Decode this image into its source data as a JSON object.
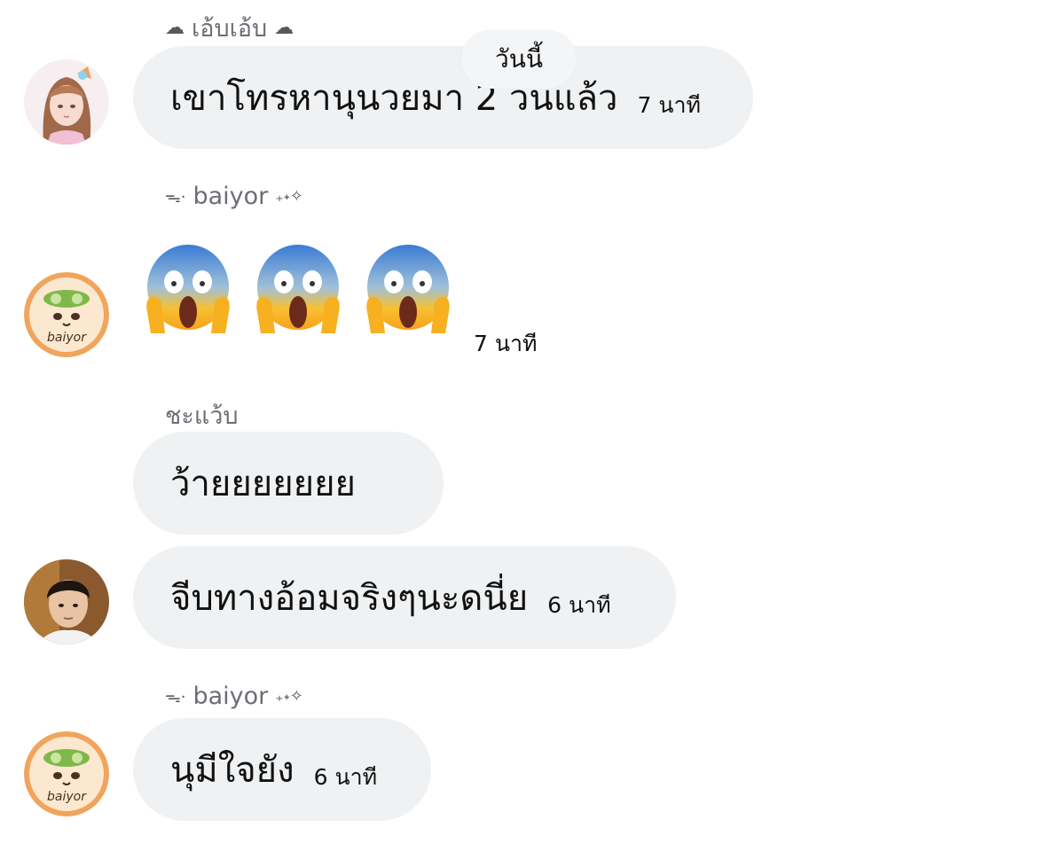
{
  "date_divider": "วันนี้",
  "messages": [
    {
      "sender": "เอ้บเอ้บ",
      "sender_prefix_icon": "cloud-icon",
      "sender_suffix_icon": "cloud-icon",
      "text": "เขาโทรหานุนวยมา 2 วนแล้ว",
      "time": "7 นาที",
      "avatar": "anime-girl-avatar"
    },
    {
      "sender": "baiyor",
      "sender_prefix_icon": "swirl-icon",
      "sender_suffix_icon": "sparkle-icon",
      "emojis": [
        "😱",
        "😱",
        "😱"
      ],
      "time": "7 นาที",
      "avatar": "baiyor-cat-avatar",
      "avatar_text": "baiyor"
    },
    {
      "sender": "ชะแว้บ",
      "text": "ว้ายยยยยยย"
    },
    {
      "text": "จีบทางอ้อมจริงๆนะดนี่ย",
      "time": "6 นาที",
      "avatar": "person-photo-avatar"
    },
    {
      "sender": "baiyor",
      "sender_prefix_icon": "swirl-icon",
      "sender_suffix_icon": "sparkle-icon",
      "text": "นุมีใจยัง",
      "time": "6 นาที",
      "avatar": "baiyor-cat-avatar",
      "avatar_text": "baiyor"
    }
  ],
  "colors": {
    "bubble_bg": "#eff1f3",
    "sender_text": "#6b6f75",
    "avatar_orange": "#f0a45c"
  }
}
